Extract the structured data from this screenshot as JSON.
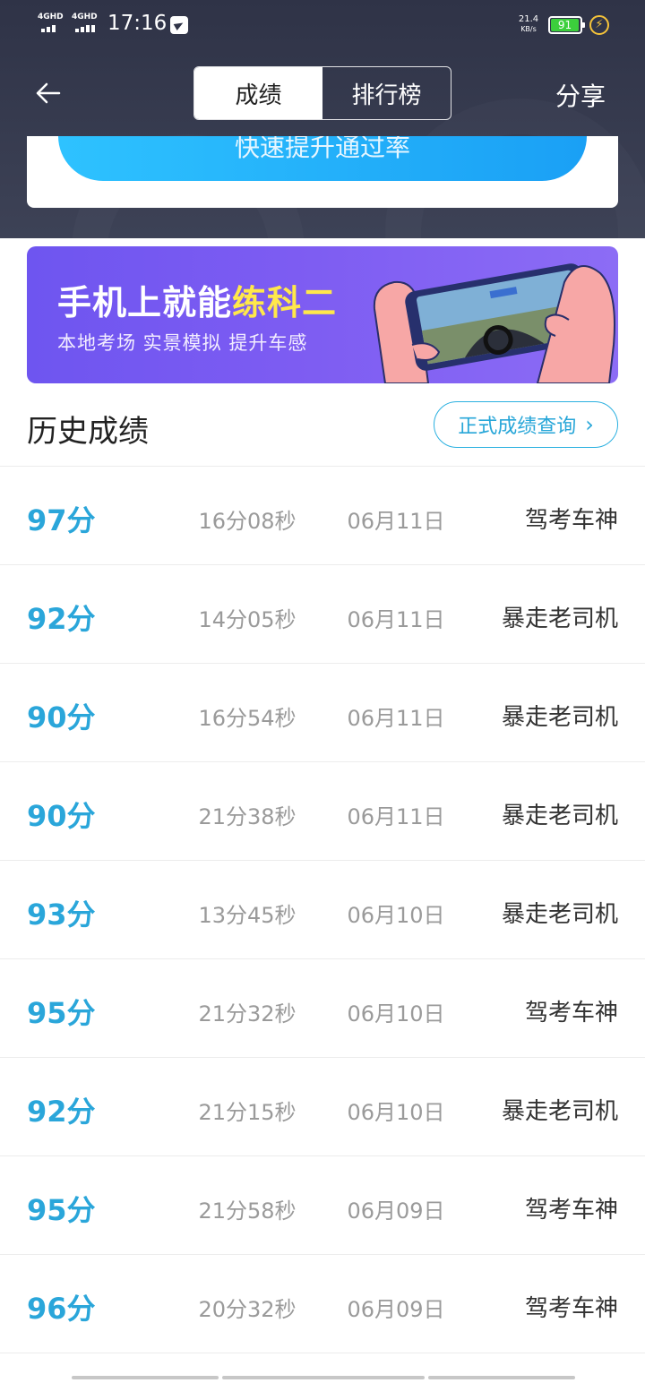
{
  "status_bar": {
    "signal1": "4GHD",
    "signal2": "4GHD",
    "time": "17:16",
    "speed_value": "21.4",
    "speed_unit": "KB/s",
    "battery": "91"
  },
  "header": {
    "tabs": [
      {
        "label": "成绩",
        "active": true
      },
      {
        "label": "排行榜",
        "active": false
      }
    ],
    "share_label": "分享"
  },
  "card": {
    "button_label": "快速提升通过率"
  },
  "banner": {
    "title_part1": "手机上就能",
    "title_highlight": "练科二",
    "subtitle": "本地考场 实景模拟 提升车感"
  },
  "history": {
    "title": "历史成绩",
    "query_button": "正式成绩查询"
  },
  "records": [
    {
      "score": "97分",
      "duration": "16分08秒",
      "date": "06月11日",
      "title": "驾考车神"
    },
    {
      "score": "92分",
      "duration": "14分05秒",
      "date": "06月11日",
      "title": "暴走老司机"
    },
    {
      "score": "90分",
      "duration": "16分54秒",
      "date": "06月11日",
      "title": "暴走老司机"
    },
    {
      "score": "90分",
      "duration": "21分38秒",
      "date": "06月11日",
      "title": "暴走老司机"
    },
    {
      "score": "93分",
      "duration": "13分45秒",
      "date": "06月10日",
      "title": "暴走老司机"
    },
    {
      "score": "95分",
      "duration": "21分32秒",
      "date": "06月10日",
      "title": "驾考车神"
    },
    {
      "score": "92分",
      "duration": "21分15秒",
      "date": "06月10日",
      "title": "暴走老司机"
    },
    {
      "score": "95分",
      "duration": "21分58秒",
      "date": "06月09日",
      "title": "驾考车神"
    },
    {
      "score": "96分",
      "duration": "20分32秒",
      "date": "06月09日",
      "title": "驾考车神"
    }
  ],
  "colors": {
    "header_bg": "#383c50",
    "accent_blue": "#2aa6da",
    "banner_purple": "#7358f1",
    "banner_highlight": "#ffe84a"
  }
}
